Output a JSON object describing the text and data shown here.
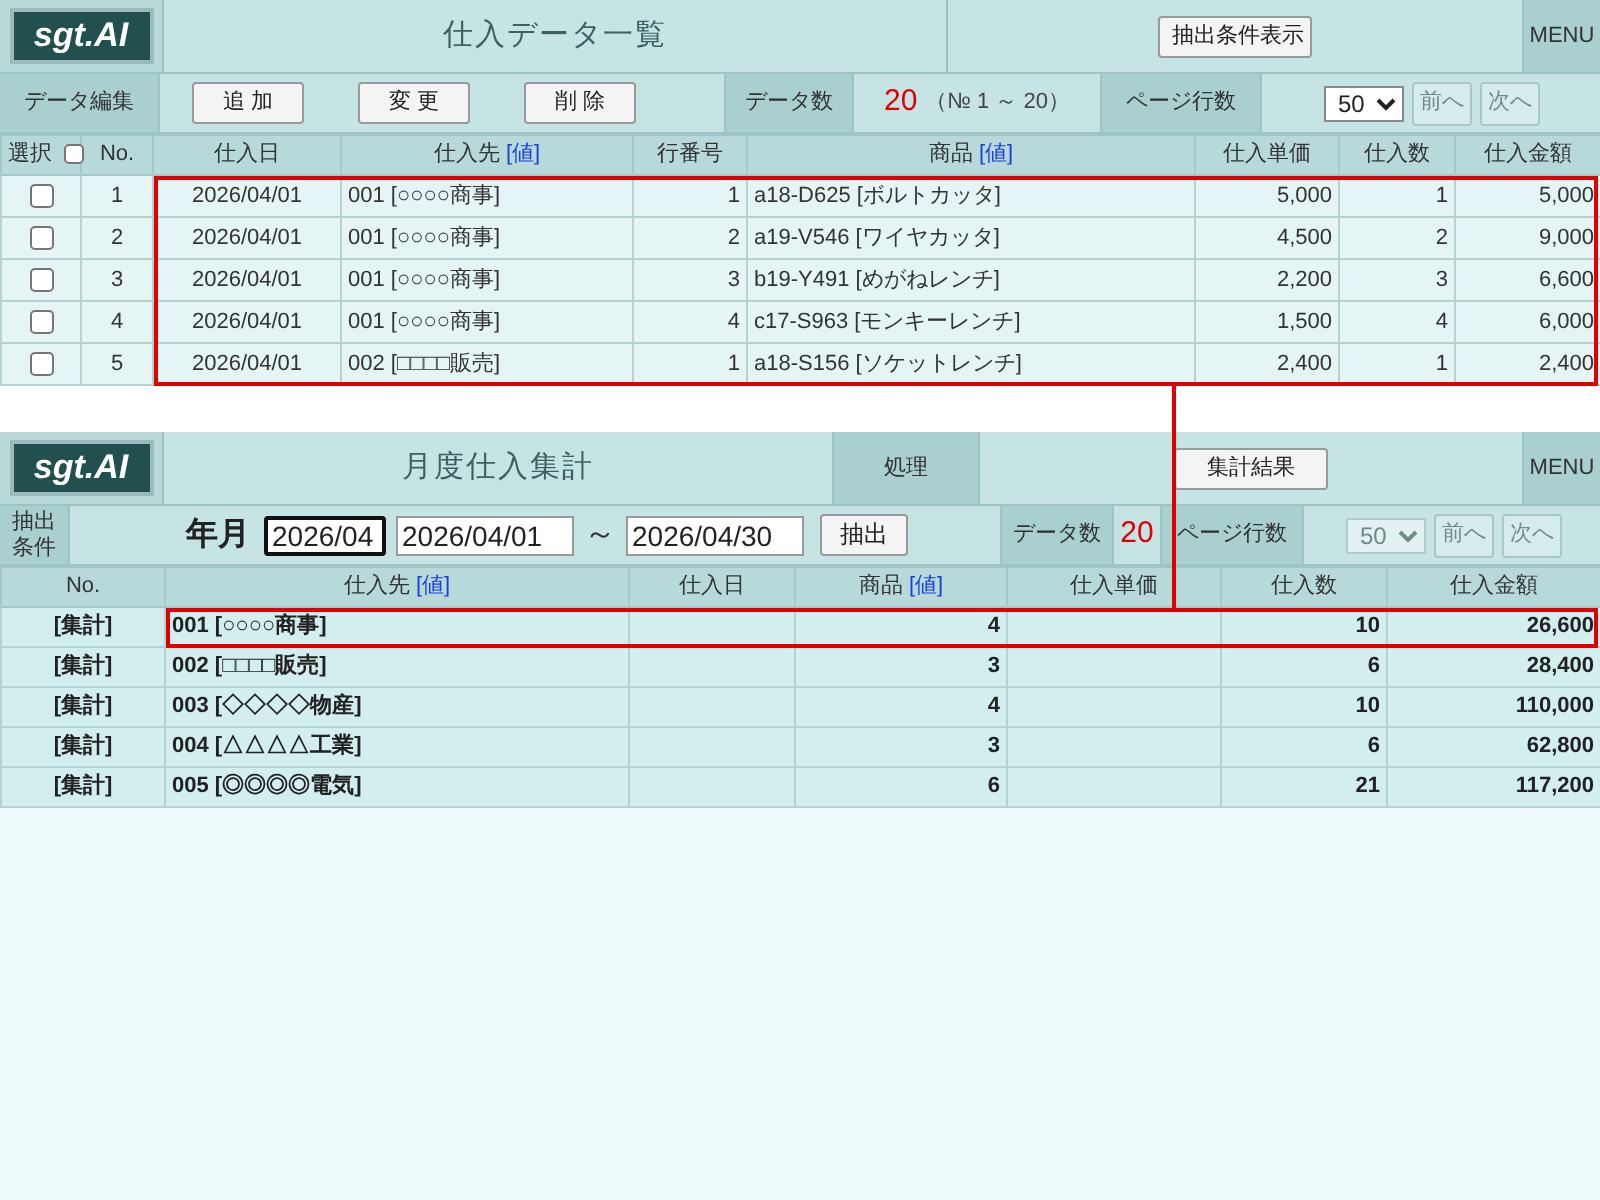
{
  "list_screen": {
    "logo": "sgt.AI",
    "title": "仕入データ一覧",
    "header_button": "抽出条件表示",
    "menu": "MENU",
    "toolbar": {
      "edit_label": "データ編集",
      "edit_buttons": [
        "追 加",
        "変 更",
        "削 除"
      ],
      "count_label": "データ数",
      "count": "20",
      "count_range": "（№ 1 ～ 20）",
      "page_rows_label": "ページ行数",
      "page_rows": {
        "value": "50",
        "disabled": false
      },
      "pager": [
        {
          "label": "前へ",
          "disabled": true
        },
        {
          "label": "次へ",
          "disabled": true
        }
      ]
    },
    "table": {
      "columns": [
        {
          "label": "選択",
          "kind": "checkbox",
          "checked": false
        },
        {
          "label": "No.",
          "kind": "text"
        },
        {
          "label": "仕入日",
          "kind": "text"
        },
        {
          "label": "仕入先",
          "kind": "text_link",
          "link": "[値]"
        },
        {
          "label": "行番号",
          "kind": "text"
        },
        {
          "label": "商品",
          "kind": "text_link",
          "link": "[値]"
        },
        {
          "label": "仕入単価",
          "kind": "text"
        },
        {
          "label": "仕入数",
          "kind": "text"
        },
        {
          "label": "仕入金額",
          "kind": "text"
        }
      ],
      "rows": [
        {
          "checked": false,
          "no": "1",
          "date": "2026/04/01",
          "supplier": "001 [○○○○商事]",
          "line_no": "1",
          "product": "a18-D625 [ボルトカッタ]",
          "unit_price": "5,000",
          "quantity": "1",
          "amount": "5,000",
          "highlighted": true
        },
        {
          "checked": false,
          "no": "2",
          "date": "2026/04/01",
          "supplier": "001 [○○○○商事]",
          "line_no": "2",
          "product": "a19-V546 [ワイヤカッタ]",
          "unit_price": "4,500",
          "quantity": "2",
          "amount": "9,000",
          "highlighted": true
        },
        {
          "checked": false,
          "no": "3",
          "date": "2026/04/01",
          "supplier": "001 [○○○○商事]",
          "line_no": "3",
          "product": "b19-Y491 [めがねレンチ]",
          "unit_price": "2,200",
          "quantity": "3",
          "amount": "6,600",
          "highlighted": true
        },
        {
          "checked": false,
          "no": "4",
          "date": "2026/04/01",
          "supplier": "001 [○○○○商事]",
          "line_no": "4",
          "product": "c17-S963 [モンキーレンチ]",
          "unit_price": "1,500",
          "quantity": "4",
          "amount": "6,000",
          "highlighted": true
        },
        {
          "checked": false,
          "no": "5",
          "date": "2026/04/01",
          "supplier": "002 [□□□□販売]",
          "line_no": "1",
          "product": "a18-S156 [ソケットレンチ]",
          "unit_price": "2,400",
          "quantity": "1",
          "amount": "2,400",
          "highlighted": true
        }
      ]
    }
  },
  "summary_screen": {
    "logo": "sgt.AI",
    "title": "月度仕入集計",
    "process_label": "処理",
    "header_button": "集計結果",
    "menu": "MENU",
    "toolbar": {
      "condition_label": "抽出条件",
      "period_label": "年月",
      "month": {
        "value": "2026/04",
        "focused": true
      },
      "date_from": {
        "value": "2026/04/01",
        "focused": false
      },
      "range_separator": "～",
      "date_to": {
        "value": "2026/04/30",
        "focused": false
      },
      "extract_button": "抽出",
      "count_label": "データ数",
      "count": "20",
      "page_rows_label": "ページ行数",
      "page_rows": {
        "value": "50",
        "disabled": true
      },
      "pager": [
        {
          "label": "前へ",
          "disabled": true
        },
        {
          "label": "次へ",
          "disabled": true
        }
      ]
    },
    "table": {
      "columns": [
        {
          "label": "No.",
          "kind": "text"
        },
        {
          "label": "仕入先",
          "kind": "text_link",
          "link": "[値]"
        },
        {
          "label": "仕入日",
          "kind": "text"
        },
        {
          "label": "商品",
          "kind": "text_link",
          "link": "[値]"
        },
        {
          "label": "仕入単価",
          "kind": "text"
        },
        {
          "label": "仕入数",
          "kind": "text"
        },
        {
          "label": "仕入金額",
          "kind": "text"
        }
      ],
      "rows": [
        {
          "no": "[集計]",
          "supplier": "001 [○○○○商事]",
          "product": "4",
          "quantity": "10",
          "amount": "26,600",
          "highlighted": true
        },
        {
          "no": "[集計]",
          "supplier": "002 [□□□□販売]",
          "product": "3",
          "quantity": "6",
          "amount": "28,400",
          "highlighted": false
        },
        {
          "no": "[集計]",
          "supplier": "003 [◇◇◇◇物産]",
          "product": "4",
          "quantity": "10",
          "amount": "110,000",
          "highlighted": false
        },
        {
          "no": "[集計]",
          "supplier": "004 [△△△△工業]",
          "product": "3",
          "quantity": "6",
          "amount": "62,800",
          "highlighted": false
        },
        {
          "no": "[集計]",
          "supplier": "005 [◎◎◎◎電気]",
          "product": "6",
          "quantity": "21",
          "amount": "117,200",
          "highlighted": false
        }
      ]
    }
  },
  "connector": true
}
